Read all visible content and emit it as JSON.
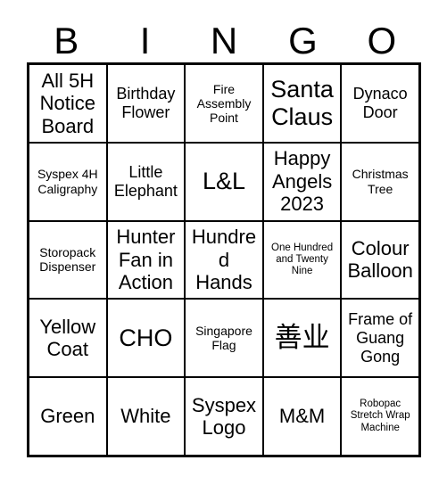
{
  "card": {
    "header_letters": [
      "B",
      "I",
      "N",
      "G",
      "O"
    ],
    "rows": [
      [
        {
          "text": "All 5H Notice Board",
          "size": "lg"
        },
        {
          "text": "Birthday Flower",
          "size": "md"
        },
        {
          "text": "Fire Assembly Point",
          "size": "sm"
        },
        {
          "text": "Santa Claus",
          "size": "xl"
        },
        {
          "text": "Dynaco Door",
          "size": "md"
        }
      ],
      [
        {
          "text": "Syspex 4H Caligraphy",
          "size": "sm"
        },
        {
          "text": "Little Elephant",
          "size": "md"
        },
        {
          "text": "L&L",
          "size": "xl"
        },
        {
          "text": "Happy Angels 2023",
          "size": "lg"
        },
        {
          "text": "Christmas Tree",
          "size": "sm"
        }
      ],
      [
        {
          "text": "Storopack Dispenser",
          "size": "sm"
        },
        {
          "text": "Hunter Fan in Action",
          "size": "lg"
        },
        {
          "text": "Hundred Hands",
          "size": "lg"
        },
        {
          "text": "One Hundred and Twenty Nine",
          "size": "xs"
        },
        {
          "text": "Colour Balloon",
          "size": "lg"
        }
      ],
      [
        {
          "text": "Yellow Coat",
          "size": "lg"
        },
        {
          "text": "CHO",
          "size": "xl"
        },
        {
          "text": "Singapore Flag",
          "size": "sm"
        },
        {
          "text": "善业",
          "size": "cjk"
        },
        {
          "text": "Frame of Guang Gong",
          "size": "md"
        }
      ],
      [
        {
          "text": "Green",
          "size": "lg"
        },
        {
          "text": "White",
          "size": "lg"
        },
        {
          "text": "Syspex Logo",
          "size": "lg"
        },
        {
          "text": "M&M",
          "size": "lg"
        },
        {
          "text": "Robopac Stretch Wrap Machine",
          "size": "xs"
        }
      ]
    ]
  },
  "colors": {
    "background": "#ffffff",
    "border": "#000000",
    "text": "#000000"
  }
}
